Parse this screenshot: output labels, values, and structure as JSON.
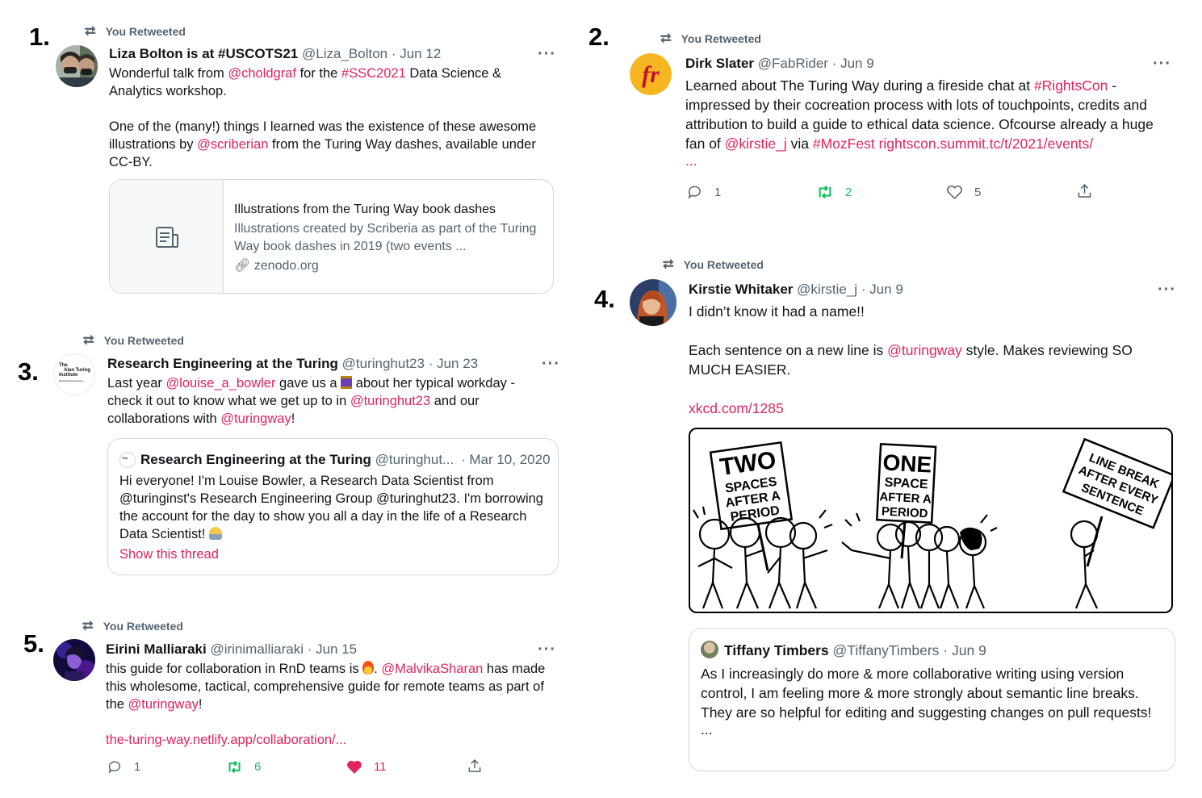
{
  "numbers": [
    "1.",
    "2.",
    "3.",
    "4.",
    "5."
  ],
  "retweet_label": "You Retweeted",
  "more_label": "···",
  "t1": {
    "name": "Liza Bolton is at #USCOTS21",
    "handle": "@Liza_Bolton",
    "date": "· Jun 12",
    "s1": "Wonderful talk from ",
    "m1": "@choldgraf",
    "s2": " for the ",
    "m2": "#SSC2021",
    "s3": " Data Science & Analytics workshop.",
    "s4": "One of the (many!) things I learned was the existence of these awesome illustrations by ",
    "m3": "@scriberian",
    "s5": " from the Turing Way dashes, available under CC-BY.",
    "card": {
      "title": "Illustrations from the Turing Way book dashes",
      "desc": "Illustrations created by Scriberia as part of the Turing Way book dashes in 2019 (two events ...",
      "domain": "zenodo.org"
    }
  },
  "t2": {
    "name": "Dirk Slater",
    "handle": "@FabRider",
    "date": "· Jun 9",
    "s1": "Learned about The Turing Way during a fireside chat at ",
    "m1": "#RightsCon",
    "s2": " - impressed by their cocreation process with lots of touchpoints, credits and attribution to build a guide to ethical data science. Ofcourse already a huge fan of ",
    "m2": "@kirstie_j",
    "s3": " via ",
    "m3": "#MozFest",
    "s4": " ",
    "m4": "rightscon.summit.tc/t/2021/events/",
    "ellipsis": "...",
    "replies": "1",
    "retweets": "2",
    "likes": "5"
  },
  "t3": {
    "name": "Research Engineering at the Turing",
    "handle": "@turinghut23",
    "date": "· Jun 23",
    "s1": "Last year ",
    "m1": "@louise_a_bowler",
    "s2": " gave us a ",
    "s3": " about her typical workday - check it out to know what we get up to in ",
    "m2": "@turinghut23",
    "s4": " and our collaborations with ",
    "m3": "@turingway",
    "s5": "!",
    "quote": {
      "name": "Research Engineering at the Turing",
      "handle": "@turinghut...",
      "date": "· Mar 10, 2020",
      "text": "Hi everyone! I'm Louise Bowler, a Research Data Scientist from @turinginst's Research Engineering Group @turinghut23. I'm borrowing the account for the day to show you all a day in the life of a Research Data Scientist!",
      "show": "Show this thread"
    },
    "avatar_lines": [
      "The",
      "Alan Turing",
      "Institute",
      "Research Engineering"
    ]
  },
  "t4": {
    "name": "Kirstie Whitaker",
    "handle": "@kirstie_j",
    "date": "· Jun 9",
    "l1": "I didn’t know it had a name!!",
    "s1": "Each sentence on a new line is ",
    "m1": "@turingway",
    "s2": " style. Makes reviewing SO MUCH EASIER.",
    "link": "xkcd.com/1285",
    "comic": {
      "sign1": [
        "TWO",
        "SPACES",
        "AFTER A",
        "PERIOD"
      ],
      "sign2": [
        "ONE",
        "SPACE",
        "AFTER A",
        "PERIOD"
      ],
      "sign3": [
        "LINE BREAK",
        "AFTER EVERY",
        "SENTENCE"
      ]
    },
    "quote": {
      "name": "Tiffany Timbers",
      "handle": "@TiffanyTimbers",
      "date": "· Jun 9",
      "text": "As I increasingly do more & more collaborative writing using version control, I am feeling more & more strongly about semantic line breaks. They are so helpful for editing and suggesting changes on pull requests!",
      "ellipsis": "..."
    }
  },
  "t5": {
    "name": "Eirini Malliaraki",
    "handle": "@irinimalliaraki",
    "date": "· Jun 15",
    "s1": "this guide for collaboration in RnD teams is ",
    "s2": ". ",
    "m1": "@MalvikaSharan",
    "s3": " has made this wholesome, tactical, comprehensive guide for remote teams as part of the ",
    "m2": "@turingway",
    "s4": "!",
    "link": "the-turing-way.netlify.app/collaboration/...",
    "replies": "1",
    "retweets": "6",
    "likes": "11"
  },
  "colors": {
    "accent": "#e0245e",
    "muted": "#536471",
    "retweet": "#17bf63",
    "like": "#e0245e"
  }
}
